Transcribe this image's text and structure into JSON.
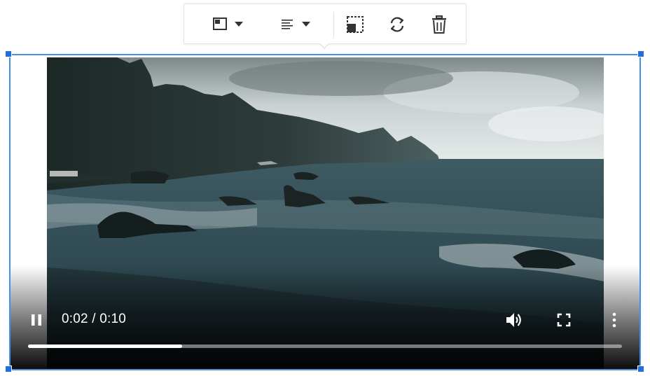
{
  "toolbar": {
    "buttons": [
      {
        "icon": "image-align-icon",
        "dropdown": true
      },
      {
        "icon": "text-align-icon",
        "dropdown": true
      },
      {
        "icon": "resize-icon",
        "dropdown": false
      },
      {
        "icon": "replace-icon",
        "dropdown": false
      },
      {
        "icon": "trash-icon",
        "dropdown": false
      }
    ]
  },
  "player": {
    "time_text": "0:02 / 0:10",
    "progress_fraction": 0.26,
    "play_state": "playing",
    "controls": [
      "pause-icon",
      "volume-icon",
      "fullscreen-icon",
      "more-options-icon"
    ]
  },
  "colors": {
    "selection_border": "#4a90e2",
    "handle": "#1e6fe0",
    "icon": "#333333"
  }
}
